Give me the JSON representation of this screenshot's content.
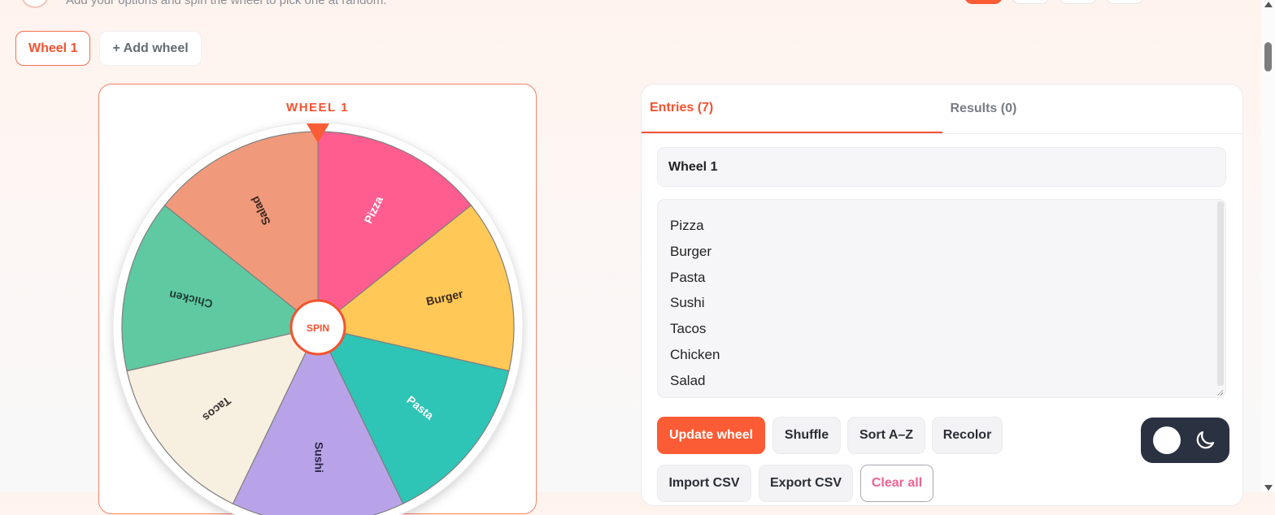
{
  "header": {
    "subtitle": "Add your options and spin the wheel to pick one at random."
  },
  "wheel_tabs": {
    "active": "Wheel 1",
    "add": "+ Add wheel"
  },
  "wheel": {
    "title": "WHEEL 1",
    "spin_label": "SPIN",
    "pointer_color": "#fb5c36",
    "segments": [
      {
        "label": "Pizza",
        "color": "#ff5d8f",
        "text_color": "#ffffff"
      },
      {
        "label": "Burger",
        "color": "#ffc857",
        "text_color": "#3a2a1a"
      },
      {
        "label": "Pasta",
        "color": "#2ec4b6",
        "text_color": "#ffffff"
      },
      {
        "label": "Sushi",
        "color": "#b9a3e8",
        "text_color": "#2b2446"
      },
      {
        "label": "Tacos",
        "color": "#f7efe0",
        "text_color": "#3a3030"
      },
      {
        "label": "Chicken",
        "color": "#5fc9a2",
        "text_color": "#1f3a32"
      },
      {
        "label": "Salad",
        "color": "#f09a7b",
        "text_color": "#3a2320"
      }
    ]
  },
  "panel": {
    "tabs": {
      "entries": "Entries (7)",
      "results": "Results (0)"
    },
    "wheel_name": "Wheel 1",
    "entries": [
      "Pizza",
      "Burger",
      "Pasta",
      "Sushi",
      "Tacos",
      "Chicken",
      "Salad"
    ],
    "buttons": {
      "update": "Update wheel",
      "shuffle": "Shuffle",
      "sort": "Sort A–Z",
      "recolor": "Recolor",
      "import_csv": "Import CSV",
      "export_csv": "Export CSV",
      "clear_all": "Clear all"
    }
  },
  "colors": {
    "accent": "#f4522f",
    "primary_button": "#fb5c36",
    "danger_text": "#f06291",
    "toggle_bg": "#2a3140"
  }
}
